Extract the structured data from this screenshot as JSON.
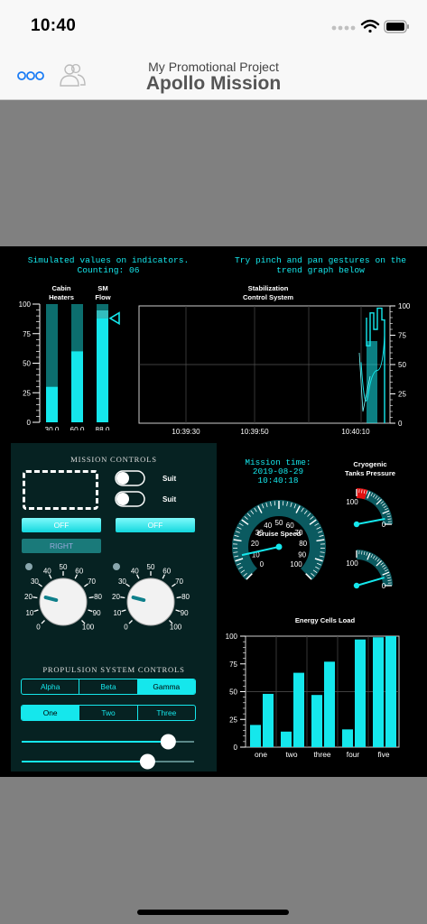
{
  "status_bar": {
    "time": "10:40"
  },
  "nav": {
    "subtitle": "My Promotional Project",
    "title": "Apollo Mission"
  },
  "info": {
    "simulated": "Simulated values on indicators.",
    "counting": "Counting: 06",
    "pinch": "Try pinch and pan gestures on the",
    "trend": "trend graph below"
  },
  "gauges": {
    "cabin_label": [
      "Cabin",
      "Heaters"
    ],
    "sm_label": [
      "SM",
      "Flow"
    ],
    "ticks": [
      "100",
      "75",
      "50",
      "25",
      "0"
    ],
    "bars": [
      {
        "name": "cabin-bar-1",
        "value": 30.0,
        "label": "30.0"
      },
      {
        "name": "cabin-bar-2",
        "value": 60.0,
        "label": "60.0"
      },
      {
        "name": "sm-flow-bar",
        "value": 88.0,
        "label": "88.0"
      }
    ]
  },
  "chart_data": [
    {
      "type": "line",
      "title": "Stabilization Control System",
      "x_ticks": [
        "10:39:30",
        "10:39:50",
        "10:40:10"
      ],
      "y_ticks": [
        "100",
        "75",
        "50",
        "25",
        "0"
      ],
      "ylim": [
        0,
        100
      ],
      "grid": true
    },
    {
      "type": "bar",
      "title": "Energy Cells Load",
      "categories": [
        "one",
        "two",
        "three",
        "four",
        "five"
      ],
      "series": [
        {
          "values": [
            20,
            14,
            47,
            16,
            99
          ]
        },
        {
          "values": [
            48,
            67,
            77,
            97,
            100
          ]
        }
      ],
      "ylim": [
        0,
        100
      ],
      "y_ticks": [
        "100",
        "75",
        "50",
        "25",
        "0"
      ],
      "grid": true
    }
  ],
  "mission_controls": {
    "title": "MISSION CONTROLS",
    "switch_labels": [
      "Suit",
      "Suit"
    ],
    "off_buttons": [
      "OFF",
      "OFF"
    ],
    "right_button": "RIGHT",
    "knob_ticks": [
      "0",
      "10",
      "20",
      "30",
      "40",
      "50",
      "60",
      "70",
      "80",
      "90",
      "100"
    ],
    "knob_values": [
      22,
      22
    ]
  },
  "propulsion": {
    "title": "PROPULSION SYSTEM CONTROLS",
    "seg1": [
      "Alpha",
      "Beta",
      "Gamma"
    ],
    "seg1_selected": 2,
    "seg2": [
      "One",
      "Two",
      "Three"
    ],
    "seg2_selected": 0,
    "slider_values": [
      0.85,
      0.73
    ]
  },
  "mission_time": {
    "label": "Mission time:",
    "date": "2019-08-29",
    "time": "10:40:18"
  },
  "cruise_speed": {
    "label": "Cruise Speed",
    "ticks": [
      "0",
      "10",
      "20",
      "30",
      "40",
      "50",
      "60",
      "70",
      "80",
      "90",
      "100"
    ],
    "value": 12
  },
  "cryogenic": {
    "label": [
      "Cryogenic",
      "Tanks Pressure"
    ],
    "ticks": [
      "100",
      "0"
    ],
    "values": [
      12,
      18
    ]
  },
  "colors": {
    "accent": "#15e7ec",
    "panel": "#062222",
    "alert": "#e01010"
  }
}
